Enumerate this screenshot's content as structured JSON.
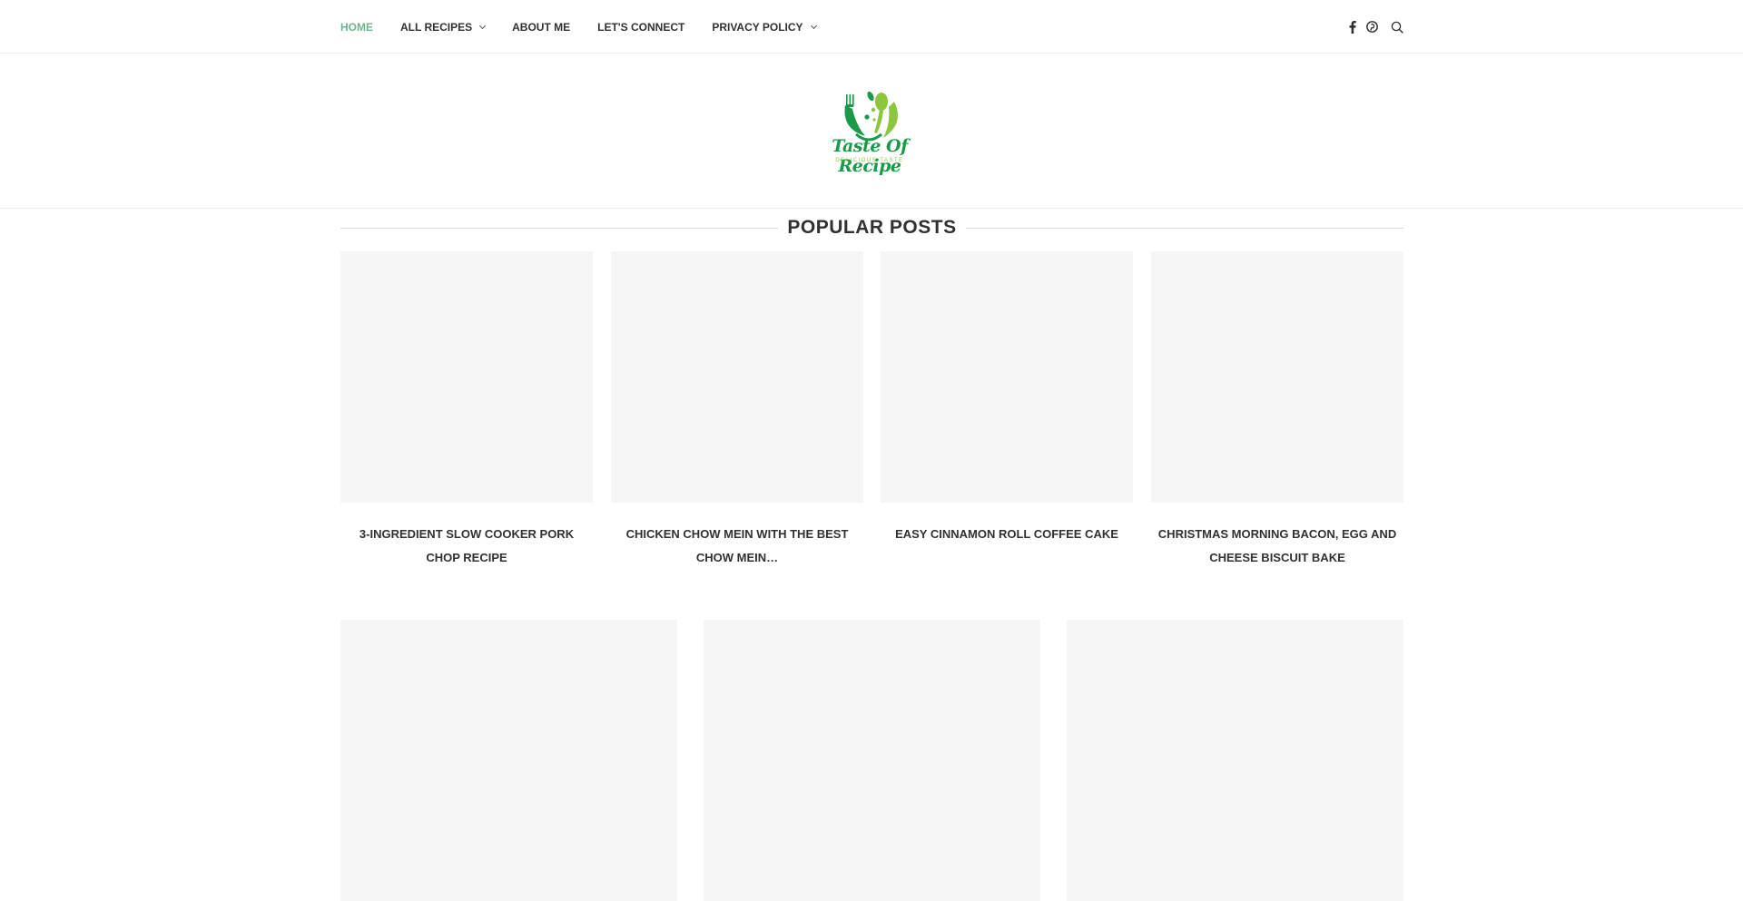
{
  "nav": {
    "items": [
      {
        "label": "HOME",
        "active": true,
        "has_dropdown": false
      },
      {
        "label": "ALL RECIPES",
        "active": false,
        "has_dropdown": true
      },
      {
        "label": "ABOUT ME",
        "active": false,
        "has_dropdown": false
      },
      {
        "label": "LET'S CONNECT",
        "active": false,
        "has_dropdown": false
      },
      {
        "label": "PRIVACY POLICY",
        "active": false,
        "has_dropdown": true
      }
    ],
    "active_color": "#6eb48c",
    "icons": [
      "facebook-icon",
      "pinterest-icon",
      "search-icon"
    ]
  },
  "logo": {
    "name": "Taste Of Recipe",
    "tagline": "DELICIOUS TASTE",
    "colors": {
      "dark_green": "#1a9a48",
      "light_green": "#8cc63f"
    }
  },
  "popular_posts": {
    "title": "POPULAR POSTS",
    "posts": [
      {
        "title": "3-INGREDIENT SLOW COOKER PORK CHOP RECIPE"
      },
      {
        "title": "CHICKEN CHOW MEIN WITH THE BEST CHOW MEIN…"
      },
      {
        "title": "EASY CINNAMON ROLL COFFEE CAKE"
      },
      {
        "title": "CHRISTMAS MORNING BACON, EGG AND CHEESE BISCUIT BAKE"
      }
    ]
  },
  "featured_posts_count": 3
}
